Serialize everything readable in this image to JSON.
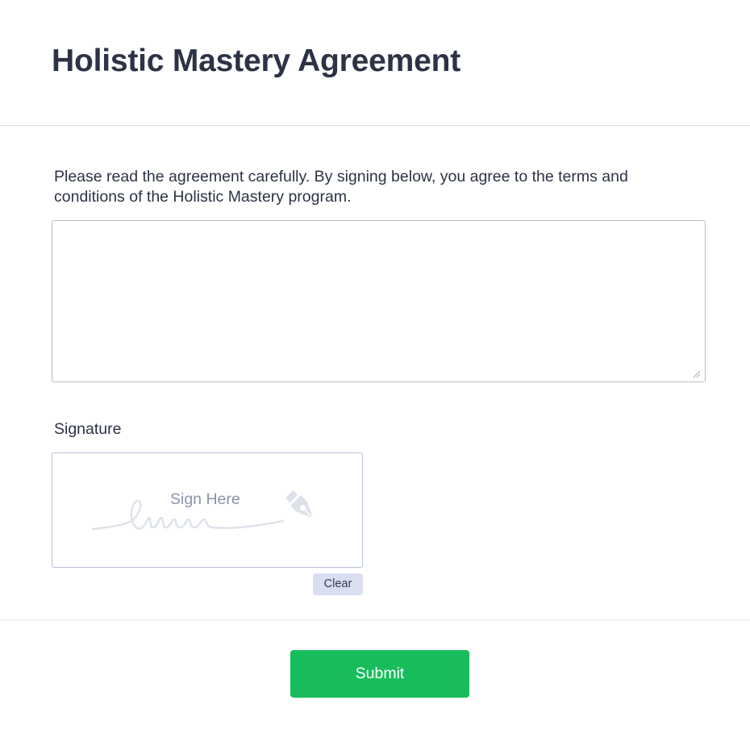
{
  "form": {
    "title": "Holistic Mastery Agreement",
    "intro": "Please read the agreement carefully. By signing below, you agree to the terms and conditions of the Holistic Mastery program.",
    "agreement_text": "",
    "signature": {
      "label": "Signature",
      "placeholder": "Sign Here",
      "clear_label": "Clear"
    },
    "submit_label": "Submit"
  },
  "icons": {
    "pen": "pen-nib-icon",
    "resize": "resize-grip-icon"
  },
  "colors": {
    "submit_bg": "#18bd5b",
    "clear_bg": "#d9def0",
    "text": "#2c3345",
    "placeholder": "#8a93ab"
  }
}
